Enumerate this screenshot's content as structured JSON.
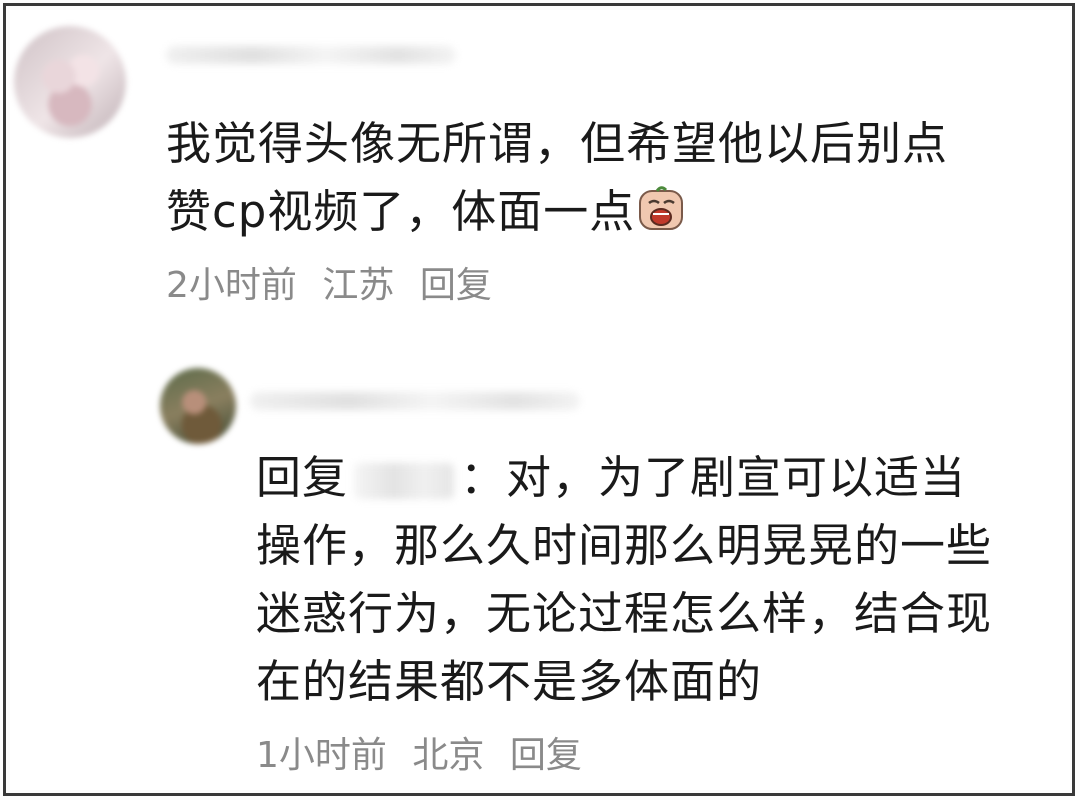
{
  "comments": [
    {
      "text_line1": "我觉得头像无所谓，但希望他以后别点",
      "text_line2": "赞cp视频了，体面一点",
      "time": "2小时前",
      "location": "江苏",
      "reply_label": "回复",
      "emoji_icon": "crying-face-sticker-icon"
    },
    {
      "reply_prefix": "回复",
      "reply_rest_line1": "：对，为了剧宣可以适当",
      "text_line2": "操作，那么久时间那么明晃晃的一些",
      "text_line3": "迷惑行为，无论过程怎么样，结合现",
      "text_line4": "在的结果都不是多体面的",
      "time": "1小时前",
      "location": "北京",
      "reply_label": "回复"
    }
  ]
}
